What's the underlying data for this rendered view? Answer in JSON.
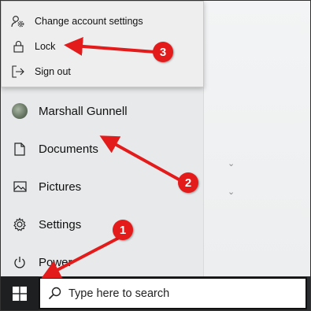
{
  "account_menu": {
    "items": [
      {
        "label": "Change account settings",
        "icon": "person-gear-icon"
      },
      {
        "label": "Lock",
        "icon": "lock-icon"
      },
      {
        "label": "Sign out",
        "icon": "sign-out-icon"
      }
    ]
  },
  "start_menu": {
    "user_name": "Marshall Gunnell",
    "items": [
      {
        "label": "Documents",
        "icon": "document-icon"
      },
      {
        "label": "Pictures",
        "icon": "picture-icon"
      },
      {
        "label": "Settings",
        "icon": "gear-icon"
      },
      {
        "label": "Power",
        "icon": "power-icon"
      }
    ]
  },
  "taskbar": {
    "start_icon": "windows-logo-icon",
    "search_placeholder": "Type here to search",
    "search_icon": "search-icon"
  },
  "annotations": {
    "badges": [
      "1",
      "2",
      "3"
    ],
    "color": "#e31b1b"
  }
}
